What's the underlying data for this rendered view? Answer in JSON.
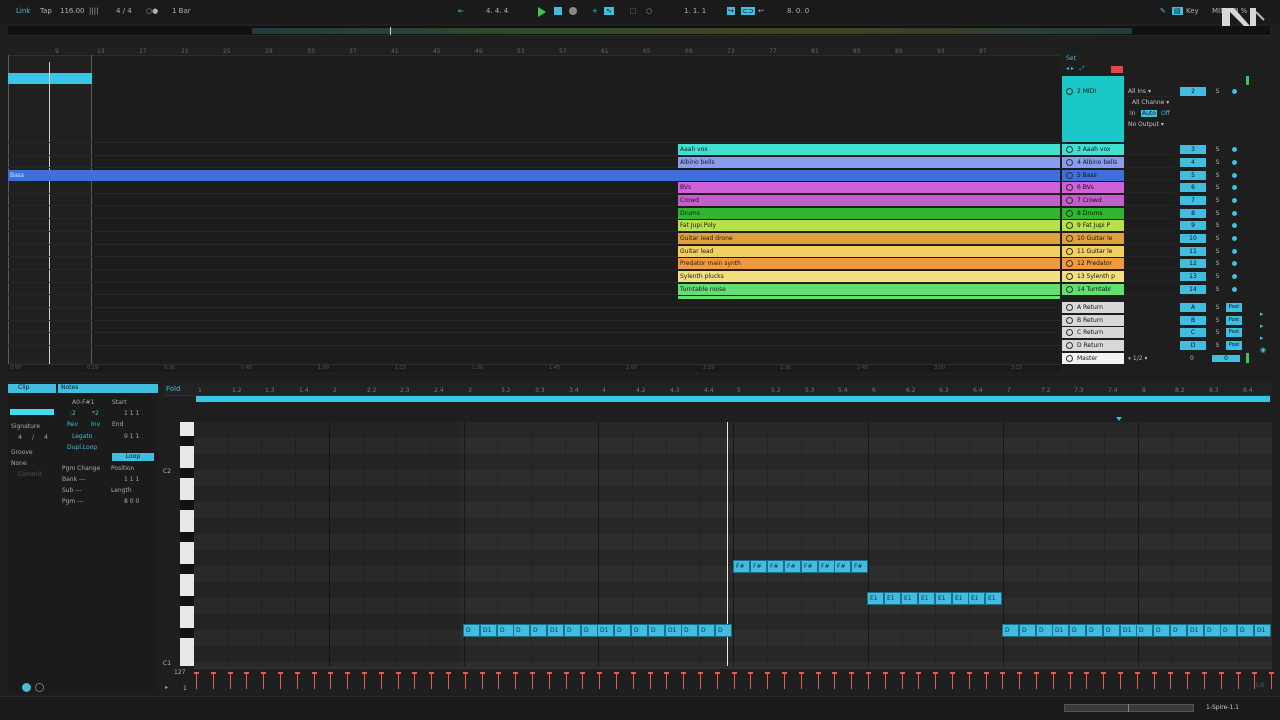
{
  "transport": {
    "link": "Link",
    "tap": "Tap",
    "tempo": "116.00",
    "signature": "4 / 4",
    "quantize": "1 Bar",
    "position": "4. 4. 4",
    "loop_start": "1. 1. 1",
    "loop_length": "8. 0. 0",
    "key": "Key",
    "midi": "MIDI",
    "cpu": "8 %"
  },
  "arrangement": {
    "ruler_marks": [
      "9",
      "13",
      "17",
      "21",
      "25",
      "29",
      "33",
      "37",
      "41",
      "45",
      "49",
      "53",
      "57",
      "61",
      "65",
      "69",
      "73",
      "77",
      "81",
      "85",
      "89",
      "93",
      "97"
    ],
    "time_marks": [
      "0:00",
      "0:15",
      "0:30",
      "0:45",
      "1:00",
      "1:15",
      "1:30",
      "1:45",
      "2:00",
      "2:15",
      "2:30",
      "2:45",
      "3:00",
      "3:15"
    ],
    "set_label": "Set",
    "clips": [
      {
        "label": "Aaah vox",
        "color": "#3fe0d0"
      },
      {
        "label": "Albino bells",
        "color": "#8a9cf0"
      },
      {
        "label": "Bass",
        "color": "#3f6fd8"
      },
      {
        "label": "BVs",
        "color": "#d060d8"
      },
      {
        "label": "Crowd",
        "color": "#c060c8"
      },
      {
        "label": "Drums",
        "color": "#2fb52f"
      },
      {
        "label": "Fat Jupi Poly",
        "color": "#b8e048"
      },
      {
        "label": "Guitar lead drone",
        "color": "#e0a040"
      },
      {
        "label": "Guitar lead",
        "color": "#f0d060"
      },
      {
        "label": "Predator main synth",
        "color": "#f09a40"
      },
      {
        "label": "Sylenth plucks",
        "color": "#f0e080"
      },
      {
        "label": "Turntable noise",
        "color": "#60e070"
      }
    ]
  },
  "tracks": [
    {
      "name": "2 MIDI",
      "num": "2",
      "color": "#1ac8c8"
    },
    {
      "name": "3 Aaah vox",
      "num": "3",
      "color": "#3fe0d0"
    },
    {
      "name": "4 Albino bells",
      "num": "4",
      "color": "#8a9cf0"
    },
    {
      "name": "5 Bass",
      "num": "5",
      "color": "#3f6fd8"
    },
    {
      "name": "6 BVs",
      "num": "6",
      "color": "#d060d8"
    },
    {
      "name": "7 Crowd",
      "num": "7",
      "color": "#c060c8"
    },
    {
      "name": "8 Drums",
      "num": "8",
      "color": "#2fb52f"
    },
    {
      "name": "9 Fat Jupi P",
      "num": "9",
      "color": "#b8e048"
    },
    {
      "name": "10 Guitar le",
      "num": "10",
      "color": "#e0a040"
    },
    {
      "name": "11 Guitar le",
      "num": "11",
      "color": "#f0d060"
    },
    {
      "name": "12 Predator",
      "num": "12",
      "color": "#f09a40"
    },
    {
      "name": "13 Sylenth p",
      "num": "13",
      "color": "#f0e080"
    },
    {
      "name": "14 Turntabl",
      "num": "14",
      "color": "#60e070"
    }
  ],
  "returns": [
    {
      "name": "A Return",
      "num": "A"
    },
    {
      "name": "B Return",
      "num": "B"
    },
    {
      "name": "C Return",
      "num": "C"
    },
    {
      "name": "D Return",
      "num": "D"
    }
  ],
  "master": {
    "name": "Master",
    "num": "0",
    "value": "0",
    "split": "1/2"
  },
  "io": {
    "input": "All Ins",
    "channel": "All Channe",
    "monitor_in": "In",
    "monitor_auto": "Auto",
    "monitor_off": "Off",
    "output": "No Output"
  },
  "solo_label": "S",
  "post_label": "Post",
  "clip_panel": {
    "clip_tab": "Clip",
    "notes_tab": "Notes",
    "signature_label": "Signature",
    "sig_num": "4",
    "sig_den": "4",
    "groove_label": "Groove",
    "groove_value": "None",
    "commit": "Commit",
    "range": "A0-F#1",
    "half": ":2",
    "double": "*2",
    "rev": "Rev",
    "inv": "Inv",
    "legato": "Legato",
    "dupl_loop": "Dupl.Loop",
    "start_label": "Start",
    "start_value": "1   1   1",
    "end_label": "End",
    "end_value": "9   1   1",
    "loop": "Loop",
    "pgm_change": "Pgm Change",
    "bank": "Bank ---",
    "sub": "Sub ---",
    "pgm": "Pgm ---",
    "position_label": "Position",
    "position_value": "1   1   1",
    "length_label": "Length",
    "length_value": "8   0   0",
    "set": "Set"
  },
  "piano_roll": {
    "fold": "Fold",
    "c2": "C2",
    "c1": "C1",
    "vel_max": "127",
    "vel_min": "1",
    "ruler": [
      "1",
      "1.2",
      "1.3",
      "1.4",
      "2",
      "2.2",
      "2.3",
      "2.4",
      "3",
      "3.2",
      "3.3",
      "3.4",
      "4",
      "4.2",
      "4.3",
      "4.4",
      "5",
      "5.2",
      "5.3",
      "5.4",
      "6",
      "6.2",
      "6.3",
      "6.4",
      "7",
      "7.2",
      "7.3",
      "7.4",
      "8",
      "8.2",
      "8.3",
      "8.4"
    ],
    "f_notes": [
      "F#",
      "F#",
      "F#",
      "F#",
      "F#",
      "F#",
      "F#",
      "F#"
    ],
    "e_notes": [
      "E1",
      "E1",
      "E1",
      "E1",
      "E1",
      "E1",
      "E1",
      "E1"
    ],
    "d_notes_a": [
      "D",
      "D1",
      "D",
      "D",
      "D",
      "D1",
      "D",
      "D",
      "D1",
      "D",
      "D",
      "D",
      "D1",
      "D",
      "D",
      "D"
    ],
    "d_notes_b": [
      "D",
      "D",
      "D",
      "D1",
      "D",
      "D",
      "D",
      "D1",
      "D",
      "D",
      "D",
      "D1",
      "D",
      "D",
      "D",
      "D1"
    ],
    "page": "1/8"
  },
  "status": {
    "device": "1-Spire-1.1"
  }
}
